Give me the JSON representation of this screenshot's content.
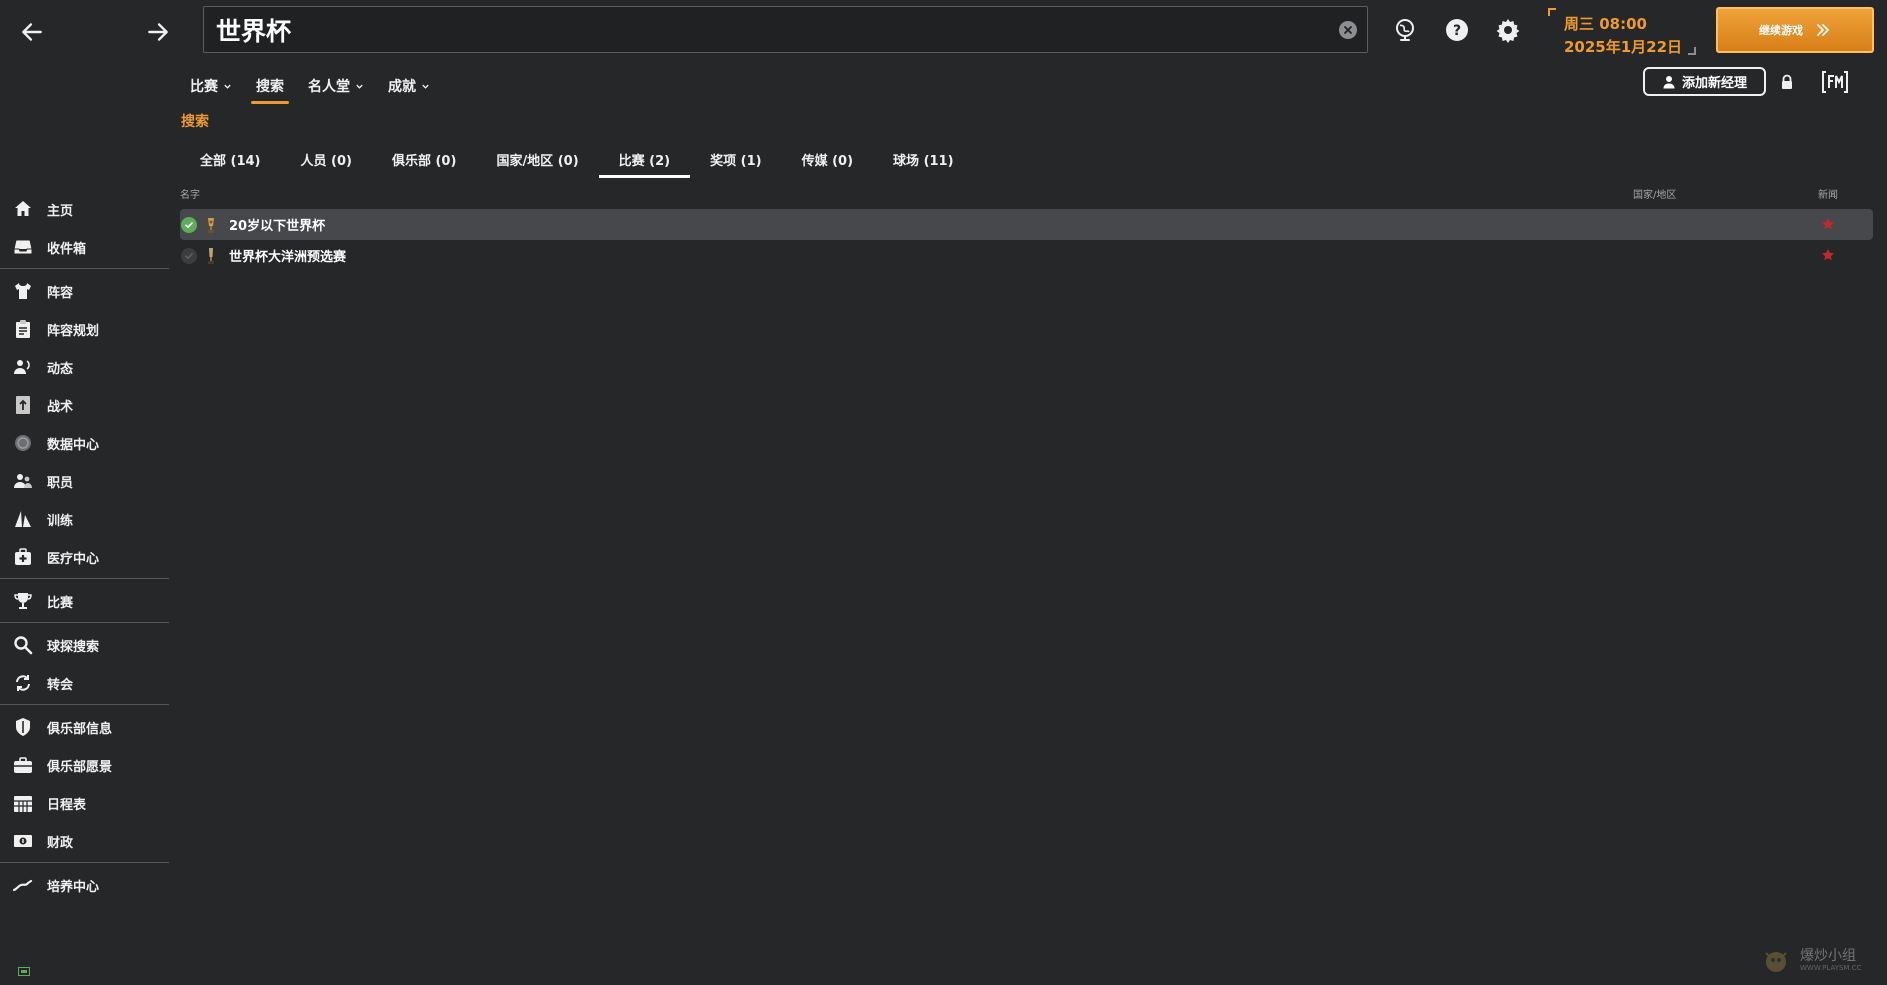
{
  "search": {
    "query": "世界杯"
  },
  "datetime": {
    "day_time": "周三 08:00",
    "date": "2025年1月22日"
  },
  "continue_button": {
    "label": "继续游戏"
  },
  "subnav": {
    "items": [
      {
        "label": "比赛",
        "dropdown": true
      },
      {
        "label": "搜索",
        "dropdown": false,
        "active": true
      },
      {
        "label": "名人堂",
        "dropdown": true
      },
      {
        "label": "成就",
        "dropdown": true
      }
    ]
  },
  "add_manager_label": "添加新经理",
  "section_title": "搜索",
  "category_tabs": [
    {
      "label": "全部 (14)"
    },
    {
      "label": "人员 (0)"
    },
    {
      "label": "俱乐部 (0)"
    },
    {
      "label": "国家/地区 (0)"
    },
    {
      "label": "比赛 (2)",
      "active": true
    },
    {
      "label": "奖项 (1)"
    },
    {
      "label": "传媒 (0)"
    },
    {
      "label": "球场 (11)"
    }
  ],
  "table": {
    "columns": {
      "name": "名字",
      "nation": "国家/地区",
      "news": "新闻"
    },
    "rows": [
      {
        "name": "20岁以下世界杯",
        "checked": true
      },
      {
        "name": "世界杯大洋洲预选赛",
        "checked": false
      }
    ]
  },
  "sidebar": {
    "items": [
      {
        "label": "主页",
        "icon": "home-icon"
      },
      {
        "label": "收件箱",
        "icon": "inbox-icon"
      },
      {
        "label": "阵容",
        "icon": "shirt-icon"
      },
      {
        "label": "阵容规划",
        "icon": "clipboard-icon"
      },
      {
        "label": "动态",
        "icon": "dynamics-icon"
      },
      {
        "label": "战术",
        "icon": "tactics-icon"
      },
      {
        "label": "数据中心",
        "icon": "data-hub-icon"
      },
      {
        "label": "职员",
        "icon": "staff-icon"
      },
      {
        "label": "训练",
        "icon": "training-icon"
      },
      {
        "label": "医疗中心",
        "icon": "medical-icon"
      },
      {
        "label": "比赛",
        "icon": "trophy-icon"
      },
      {
        "label": "球探搜索",
        "icon": "search-icon"
      },
      {
        "label": "转会",
        "icon": "transfer-icon"
      },
      {
        "label": "俱乐部信息",
        "icon": "shield-icon"
      },
      {
        "label": "俱乐部愿景",
        "icon": "briefcase-icon"
      },
      {
        "label": "日程表",
        "icon": "calendar-icon"
      },
      {
        "label": "财政",
        "icon": "finance-icon"
      },
      {
        "label": "培养中心",
        "icon": "development-icon"
      }
    ]
  },
  "watermark": {
    "line1": "爆炒小组",
    "line2": "WWW.PLAYSM.CC"
  },
  "colors": {
    "background": "#262729",
    "accent": "#ee9a2e",
    "highlight_row": "#47484b",
    "check_green": "#5dae5b",
    "star_red": "#c0282b"
  }
}
